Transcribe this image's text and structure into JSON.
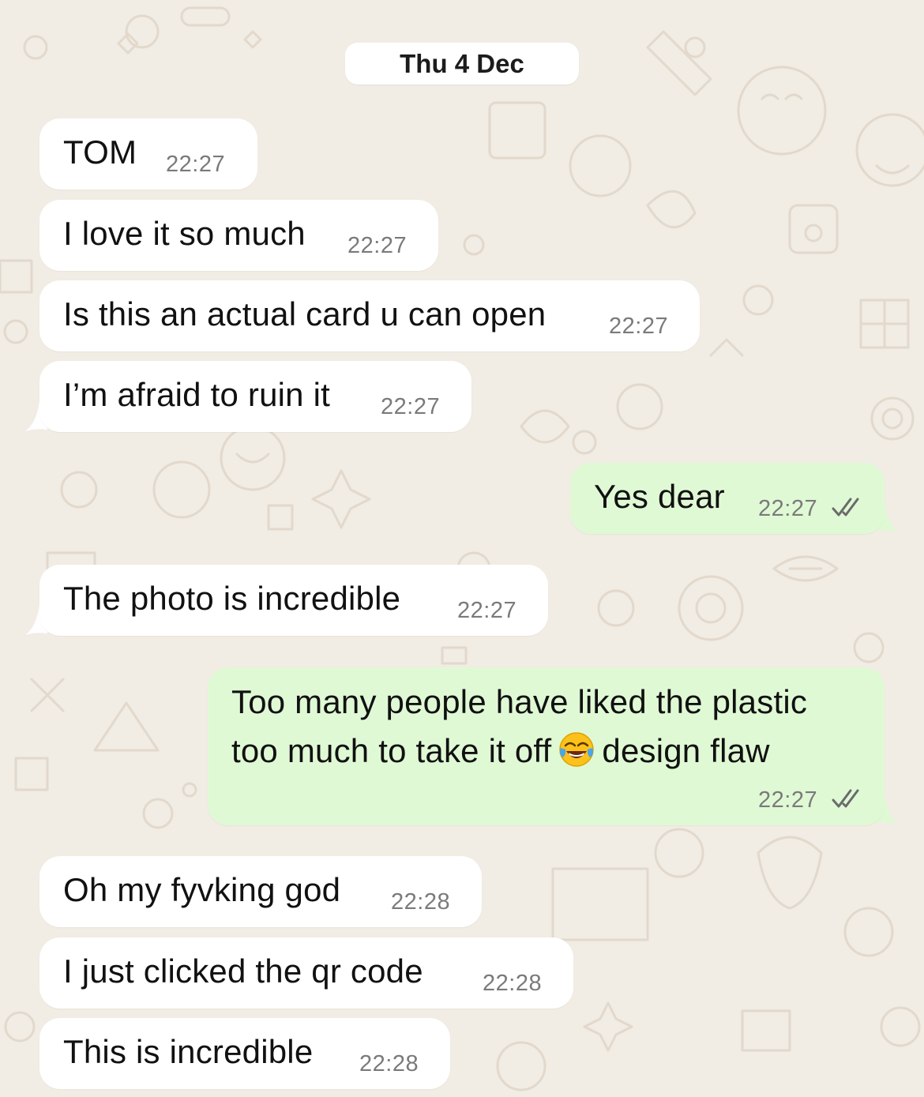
{
  "chat": {
    "date_separator": "Thu 4 Dec",
    "colors": {
      "background": "#f1ece4",
      "incoming_bubble": "#ffffff",
      "outgoing_bubble": "#e0f9d5",
      "read_ticks": "#6b6b6b"
    },
    "messages": [
      {
        "direction": "incoming",
        "text": "TOM",
        "time": "22:27"
      },
      {
        "direction": "incoming",
        "text": "I love it so much",
        "time": "22:27"
      },
      {
        "direction": "incoming",
        "text": "Is this an actual card u can open",
        "time": "22:27"
      },
      {
        "direction": "incoming",
        "text": "I’m afraid to ruin it",
        "time": "22:27"
      },
      {
        "direction": "outgoing",
        "text": "Yes dear",
        "time": "22:27",
        "status_icon": "double-check-icon"
      },
      {
        "direction": "incoming",
        "text": "The photo is incredible",
        "time": "22:27"
      },
      {
        "direction": "outgoing",
        "line1": "Too many people have liked the plastic",
        "line2_before_emoji": "too much to take it off",
        "emoji": "face-with-tears-of-joy-icon",
        "line2_after_emoji": "design flaw",
        "time": "22:27",
        "status_icon": "double-check-icon"
      },
      {
        "direction": "incoming",
        "text": "Oh my fyvking god",
        "time": "22:28"
      },
      {
        "direction": "incoming",
        "text": "I just clicked the qr code",
        "time": "22:28"
      },
      {
        "direction": "incoming",
        "text": "This is incredible",
        "time": "22:28"
      }
    ]
  }
}
